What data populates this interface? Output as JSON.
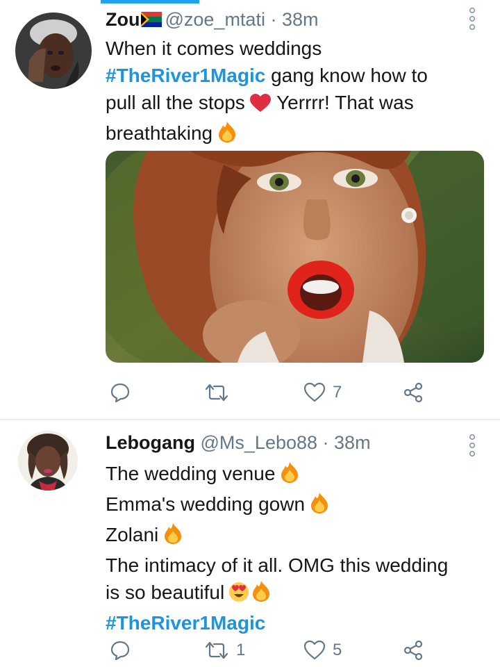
{
  "tweets": [
    {
      "name": "Zou",
      "handle": "@zoe_mtati",
      "time": "· 38m",
      "lines": [
        "When it comes weddings",
        "gang know how to",
        "pull all the stops",
        "Yerrrr! That was",
        "breathtaking"
      ],
      "hashtag": "#TheRiver1Magic",
      "reply_count": "",
      "retweet_count": "",
      "like_count": "7",
      "flag_icon": "south-africa-flag-icon",
      "emojis": [
        "red-heart-emoji",
        "fire-emoji"
      ]
    },
    {
      "name": "Lebogang",
      "handle": "@Ms_Lebo88",
      "time": "· 38m",
      "lines": [
        "The wedding venue",
        "Emma's wedding gown",
        "Zolani",
        "The intimacy of it all. OMG this wedding",
        "is so beautiful"
      ],
      "hashtag": "#TheRiver1Magic",
      "reply_count": "",
      "retweet_count": "1",
      "like_count": "5",
      "emojis": [
        "fire-emoji",
        "heart-eyes-emoji"
      ]
    }
  ],
  "colors": {
    "accent": "#1da1f2",
    "hashtag": "#1b95e0",
    "meta": "#657786",
    "heart": "#e0245e",
    "divider": "#e1e8ed"
  }
}
